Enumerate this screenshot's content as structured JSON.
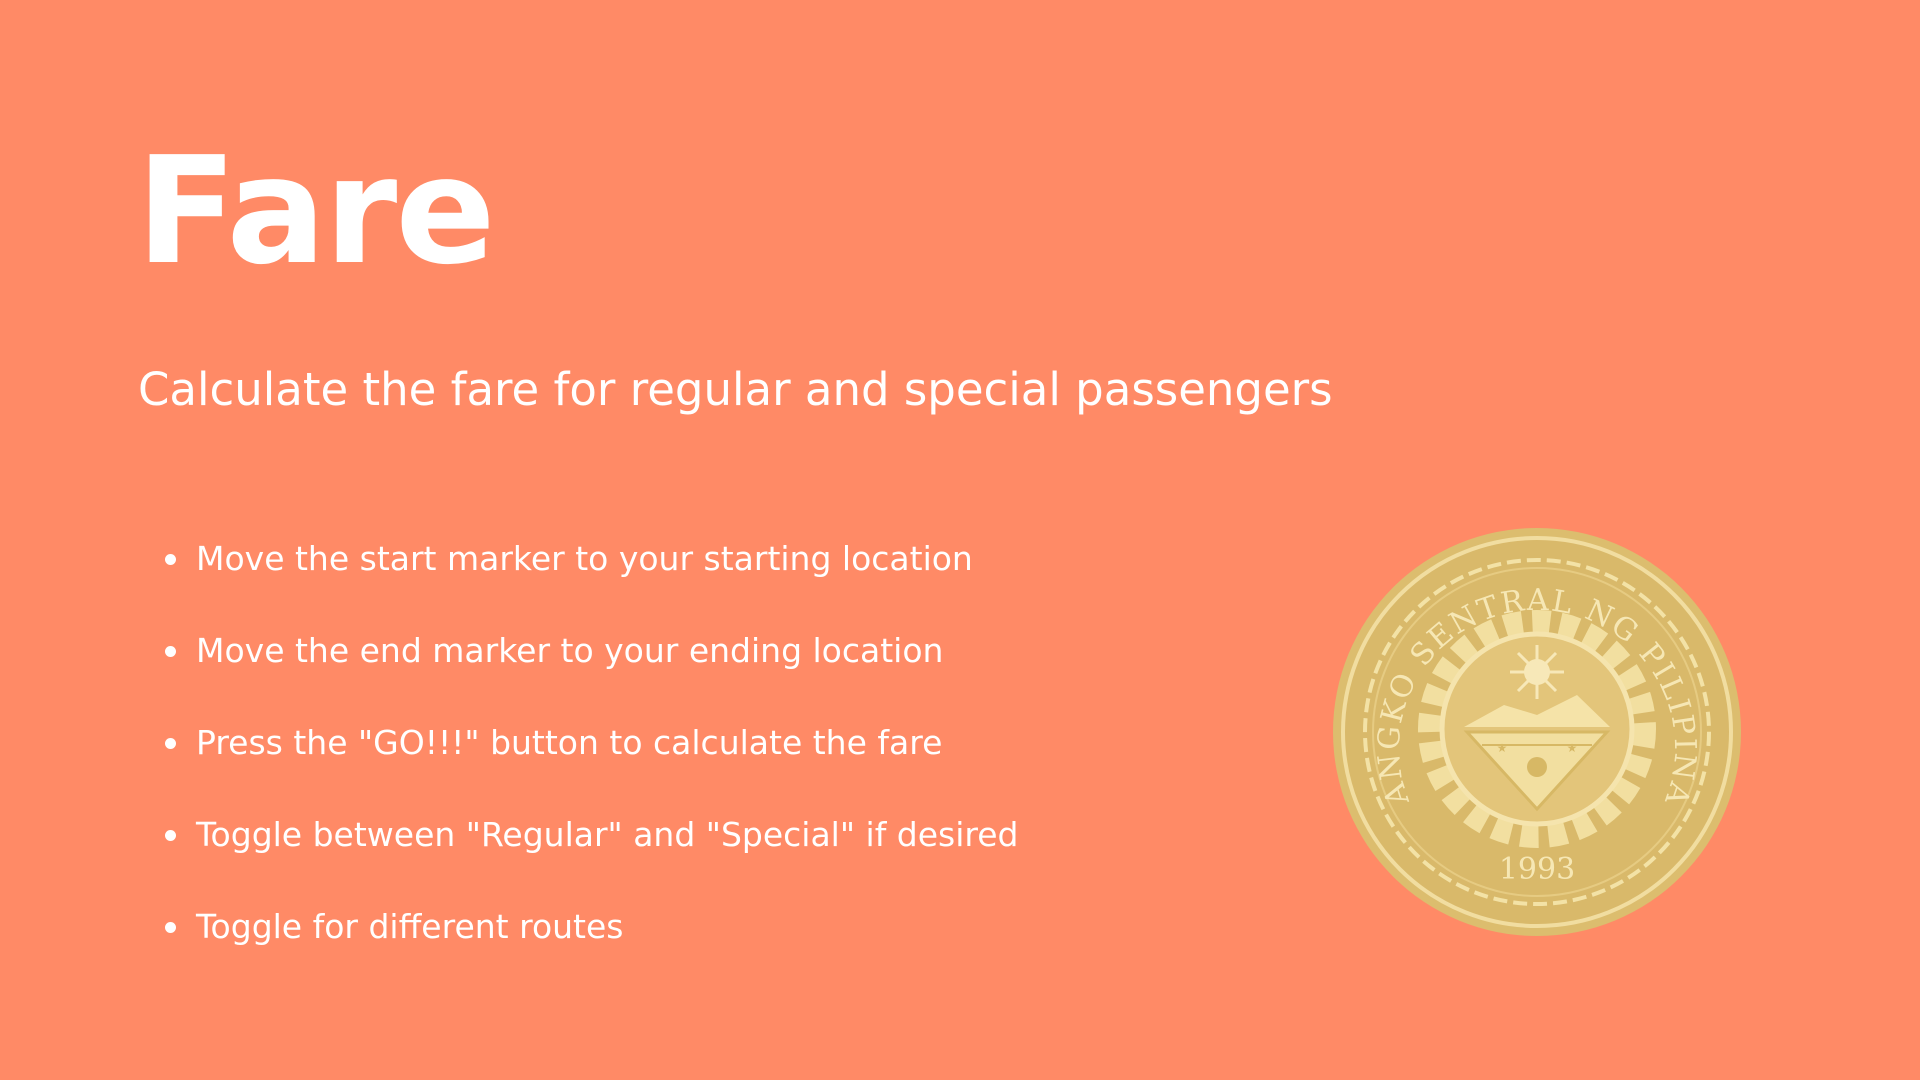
{
  "slide": {
    "title": "Fare",
    "subtitle": "Calculate the fare for regular and special passengers",
    "steps": [
      {
        "text": "Move the start marker to your starting location"
      },
      {
        "text": "Move the end marker to your ending location"
      },
      {
        "text": "Press the \"GO!!!\" button to calculate the fare"
      },
      {
        "text": "Toggle between \"Regular\" and \"Special\" if desired"
      },
      {
        "text": "Toggle for different routes"
      }
    ]
  },
  "coin": {
    "icon": "bangko-sentral-coin-seal",
    "inscription": "BANGKO SENTRAL NG PILIPINAS",
    "year": "1993"
  },
  "colors": {
    "background": "#ff8a66",
    "text": "#ffffff",
    "coin_gold": "#dcbd6e",
    "coin_light": "#f5e3a8"
  }
}
